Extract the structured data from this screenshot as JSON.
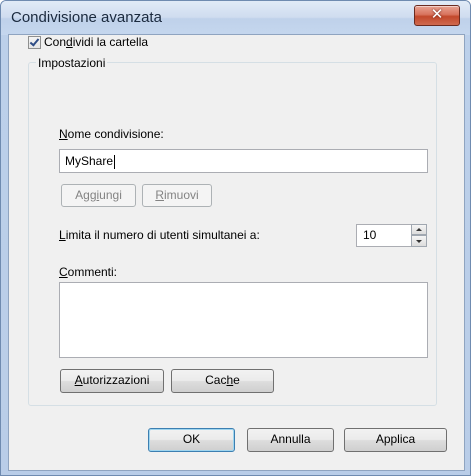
{
  "window": {
    "title": "Condivisione avanzata",
    "close_glyph": "✕"
  },
  "share_checkbox": {
    "checked": true,
    "label_pre": "Con",
    "label_mnemonic": "d",
    "label_post": "ividi la cartella"
  },
  "settings": {
    "legend": "Impostazioni",
    "share_name": {
      "label_mnemonic": "N",
      "label_post": "ome condivisione:",
      "value": "MyShare"
    },
    "add_button": {
      "pre": "Agg",
      "mnemonic": "i",
      "post": "ungi"
    },
    "remove_button": {
      "pre": "",
      "mnemonic": "R",
      "post": "imuovi"
    },
    "limit": {
      "label_mnemonic": "L",
      "label_post": "imita il numero di utenti simultanei a:",
      "value": "10"
    },
    "comments": {
      "label_mnemonic": "C",
      "label_post": "ommenti:",
      "value": ""
    },
    "permissions_button": {
      "pre": "",
      "mnemonic": "A",
      "post": "utorizzazioni"
    },
    "cache_button": {
      "pre": "Cac",
      "mnemonic": "h",
      "post": "e"
    }
  },
  "footer": {
    "ok": "OK",
    "cancel": "Annulla",
    "apply": "Applica"
  },
  "colors": {
    "dialog_bg": "#f0f0f0",
    "close_button": "#c2482b",
    "checkmark": "#2f4d86"
  },
  "icons": {
    "close": "close-icon",
    "spin_up": "chevron-up-icon",
    "spin_down": "chevron-down-icon",
    "checkmark": "checkmark-icon"
  }
}
